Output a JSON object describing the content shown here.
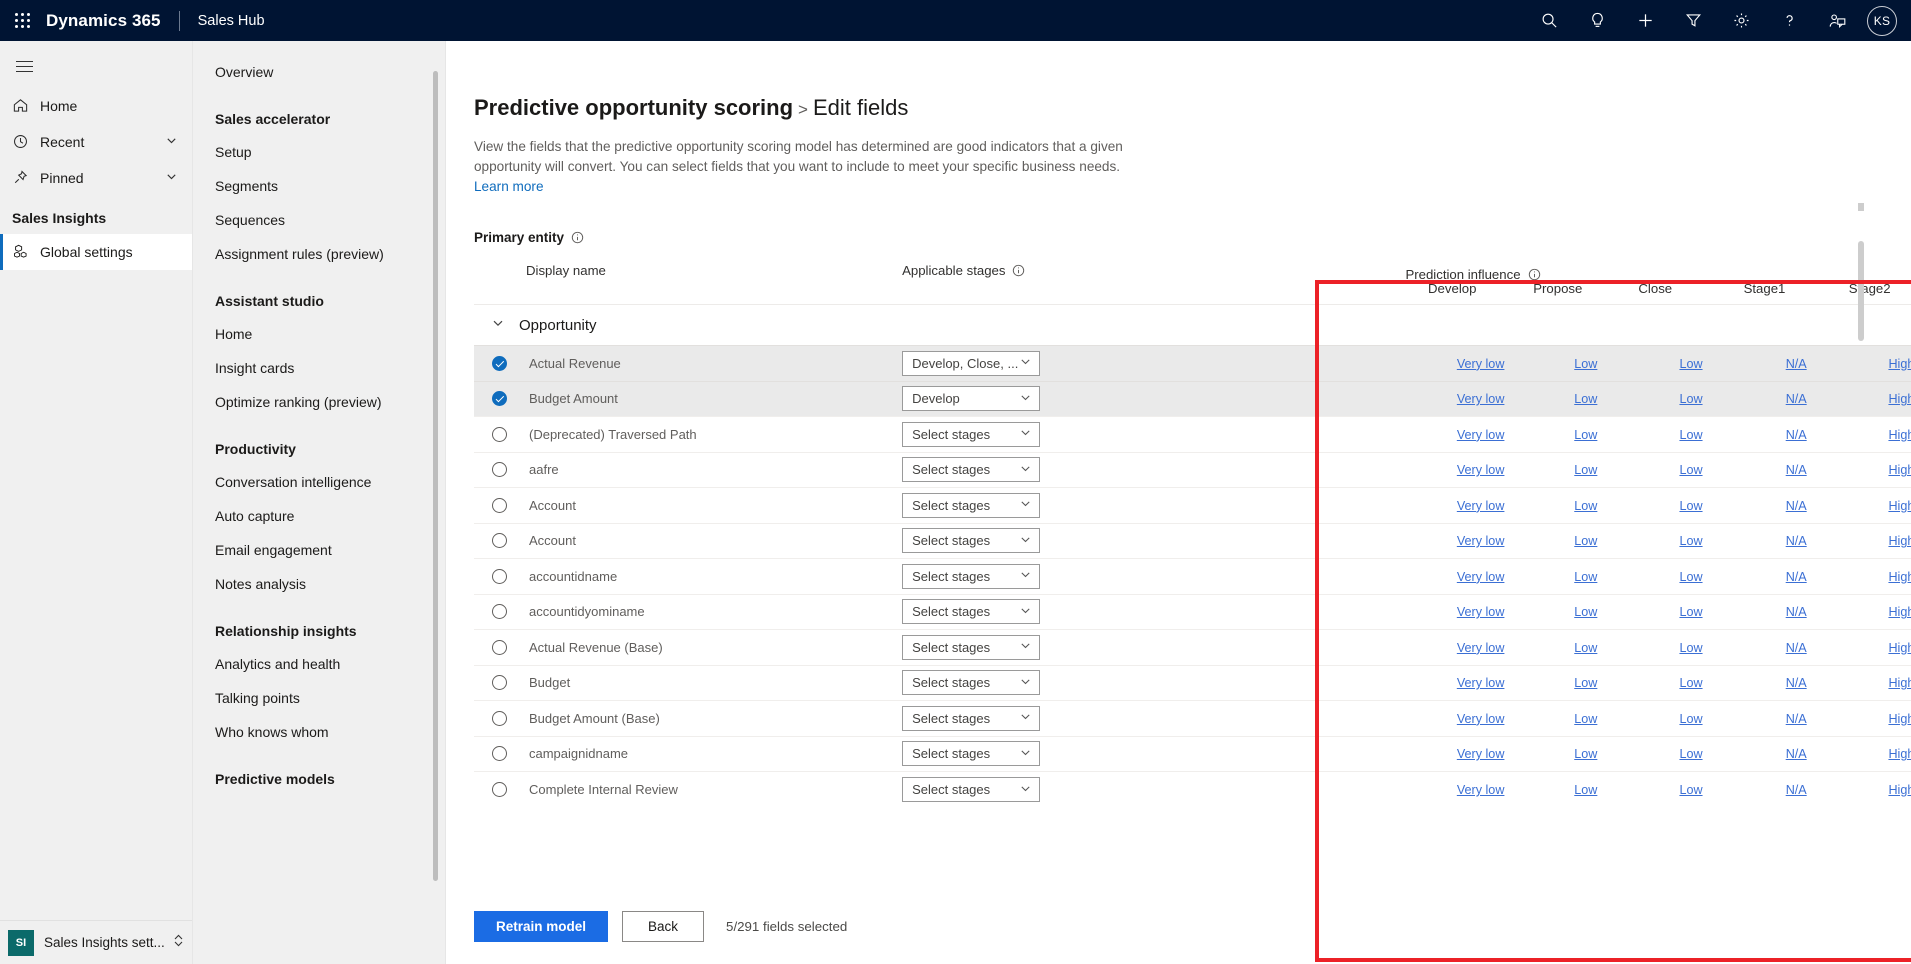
{
  "topbar": {
    "waffle_icon": "app-launcher-icon",
    "brand": "Dynamics 365",
    "app_title": "Sales Hub",
    "actions": [
      {
        "name": "search-icon",
        "label": "Search"
      },
      {
        "name": "lightbulb-icon",
        "label": "Insights"
      },
      {
        "name": "plus-icon",
        "label": "Quick create"
      },
      {
        "name": "filter-icon",
        "label": "Filter"
      },
      {
        "name": "gear-icon",
        "label": "Settings"
      },
      {
        "name": "help-icon",
        "label": "Help"
      },
      {
        "name": "assistant-icon",
        "label": "Assistant"
      }
    ],
    "avatar_initials": "KS"
  },
  "sitenav": {
    "hamburger_label": "Site map",
    "items": [
      {
        "label": "Home",
        "icon": "home-icon",
        "chevron": false,
        "selected": false
      },
      {
        "label": "Recent",
        "icon": "clock-icon",
        "chevron": true,
        "selected": false
      },
      {
        "label": "Pinned",
        "icon": "pin-icon",
        "chevron": true,
        "selected": false
      }
    ],
    "group_title": "Sales Insights",
    "group_items": [
      {
        "label": "Global settings",
        "icon": "settings-cube-icon",
        "selected": true
      }
    ],
    "footer": {
      "badge": "SI",
      "label": "Sales Insights sett...",
      "caret_icon": "chevron-up-down-icon"
    }
  },
  "subnav": {
    "top_items": [
      {
        "label": "Overview"
      }
    ],
    "sections": [
      {
        "title": "Sales accelerator",
        "items": [
          {
            "label": "Setup"
          },
          {
            "label": "Segments"
          },
          {
            "label": "Sequences"
          },
          {
            "label": "Assignment rules (preview)"
          }
        ]
      },
      {
        "title": "Assistant studio",
        "items": [
          {
            "label": "Home"
          },
          {
            "label": "Insight cards"
          },
          {
            "label": "Optimize ranking (preview)"
          }
        ]
      },
      {
        "title": "Productivity",
        "items": [
          {
            "label": "Conversation intelligence"
          },
          {
            "label": "Auto capture"
          },
          {
            "label": "Email engagement"
          },
          {
            "label": "Notes analysis"
          }
        ]
      },
      {
        "title": "Relationship insights",
        "items": [
          {
            "label": "Analytics and health"
          },
          {
            "label": "Talking points"
          },
          {
            "label": "Who knows whom"
          }
        ]
      },
      {
        "title": "Predictive models",
        "items": []
      }
    ]
  },
  "page": {
    "breadcrumb_parent": "Predictive opportunity scoring",
    "breadcrumb_sep": ">",
    "breadcrumb_current": "Edit fields",
    "description": "View the fields that the predictive opportunity scoring model has determined are good indicators that a given opportunity will convert. You can select fields that you want to include to meet your specific business needs.",
    "learn_more": "Learn more",
    "primary_entity_label": "Primary entity",
    "primary_entity_info_icon": "info-icon"
  },
  "table": {
    "headers": {
      "display_name": "Display name",
      "applicable_stages": "Applicable stages",
      "applicable_stages_info_icon": "info-icon",
      "prediction_influence": "Prediction influence",
      "prediction_influence_info_icon": "info-icon",
      "influence_columns": [
        "Develop",
        "Propose",
        "Close",
        "Stage1",
        "Stage2"
      ]
    },
    "group": {
      "label": "Opportunity",
      "chevron_icon": "chevron-down-icon",
      "expanded": true
    },
    "stage_placeholder": "Select stages",
    "rows": [
      {
        "name": "Actual Revenue",
        "selected": true,
        "stages": "Develop, Close, ...",
        "influence": [
          "Very low",
          "Low",
          "Low",
          "N/A",
          "High"
        ]
      },
      {
        "name": "Budget Amount",
        "selected": true,
        "stages": "Develop",
        "influence": [
          "Very low",
          "Low",
          "Low",
          "N/A",
          "High"
        ]
      },
      {
        "name": "(Deprecated) Traversed Path",
        "selected": false,
        "stages": "Select stages",
        "influence": [
          "Very low",
          "Low",
          "Low",
          "N/A",
          "High"
        ]
      },
      {
        "name": "aafre",
        "selected": false,
        "stages": "Select stages",
        "influence": [
          "Very low",
          "Low",
          "Low",
          "N/A",
          "High"
        ]
      },
      {
        "name": "Account",
        "selected": false,
        "stages": "Select stages",
        "influence": [
          "Very low",
          "Low",
          "Low",
          "N/A",
          "High"
        ]
      },
      {
        "name": "Account",
        "selected": false,
        "stages": "Select stages",
        "influence": [
          "Very low",
          "Low",
          "Low",
          "N/A",
          "High"
        ]
      },
      {
        "name": "accountidname",
        "selected": false,
        "stages": "Select stages",
        "influence": [
          "Very low",
          "Low",
          "Low",
          "N/A",
          "High"
        ]
      },
      {
        "name": "accountidyominame",
        "selected": false,
        "stages": "Select stages",
        "influence": [
          "Very low",
          "Low",
          "Low",
          "N/A",
          "High"
        ]
      },
      {
        "name": "Actual Revenue (Base)",
        "selected": false,
        "stages": "Select stages",
        "influence": [
          "Very low",
          "Low",
          "Low",
          "N/A",
          "High"
        ]
      },
      {
        "name": "Budget",
        "selected": false,
        "stages": "Select stages",
        "influence": [
          "Very low",
          "Low",
          "Low",
          "N/A",
          "High"
        ]
      },
      {
        "name": "Budget Amount (Base)",
        "selected": false,
        "stages": "Select stages",
        "influence": [
          "Very low",
          "Low",
          "Low",
          "N/A",
          "High"
        ]
      },
      {
        "name": "campaignidname",
        "selected": false,
        "stages": "Select stages",
        "influence": [
          "Very low",
          "Low",
          "Low",
          "N/A",
          "High"
        ]
      },
      {
        "name": "Complete Internal Review",
        "selected": false,
        "stages": "Select stages",
        "influence": [
          "Very low",
          "Low",
          "Low",
          "N/A",
          "High"
        ]
      }
    ]
  },
  "footer": {
    "retrain_label": "Retrain model",
    "back_label": "Back",
    "selection_count": "5/291 fields selected"
  },
  "annotation": {
    "color": "#ec2127"
  }
}
